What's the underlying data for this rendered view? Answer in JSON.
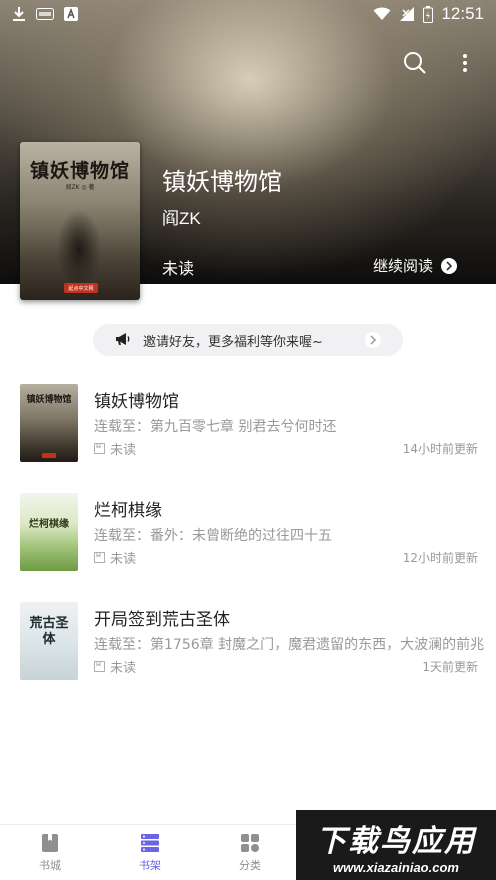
{
  "status_bar": {
    "time": "12:51",
    "left_icons": [
      "download-icon",
      "app-icon",
      "a-icon"
    ],
    "right_icons": [
      "wifi-icon",
      "signal-icon",
      "battery-icon"
    ]
  },
  "header": {
    "book_title": "镇妖博物馆",
    "author": "阎ZK",
    "read_status": "未读",
    "continue_label": "继续阅读",
    "cover_art_title": "镇妖博物馆",
    "cover_art_author": "阎ZK ◎ 著",
    "cover_badge": "起点中文网"
  },
  "invite_banner": {
    "text": "邀请好友，更多福利等你来喔~",
    "icon": "megaphone-icon"
  },
  "books": [
    {
      "title": "镇妖博物馆",
      "chapter": "连载至：第九百零七章 别君去兮何时还",
      "status": "未读",
      "updated": "14小时前更新",
      "cover_art": "镇妖博物馆"
    },
    {
      "title": "烂柯棋缘",
      "chapter": "连载至：番外：未曾断绝的过往四十五",
      "status": "未读",
      "updated": "12小时前更新",
      "cover_art": "烂柯棋缘"
    },
    {
      "title": "开局签到荒古圣体",
      "chapter": "连载至：第1756章 封魔之门，魔君遗留的东西，大波澜的前兆",
      "status": "未读",
      "updated": "1天前更新",
      "cover_art": "荒古圣体"
    }
  ],
  "bottom_nav": {
    "items": [
      {
        "label": "书城",
        "icon": "book-icon",
        "active": false
      },
      {
        "label": "书架",
        "icon": "bookshelf-icon",
        "active": true
      },
      {
        "label": "分类",
        "icon": "category-icon",
        "active": false
      }
    ],
    "active_color": "#6b63e8",
    "inactive_color": "#8f8f8f"
  },
  "watermark": {
    "main": "下载鸟应用",
    "sub": "www.xiazainiao.com"
  }
}
